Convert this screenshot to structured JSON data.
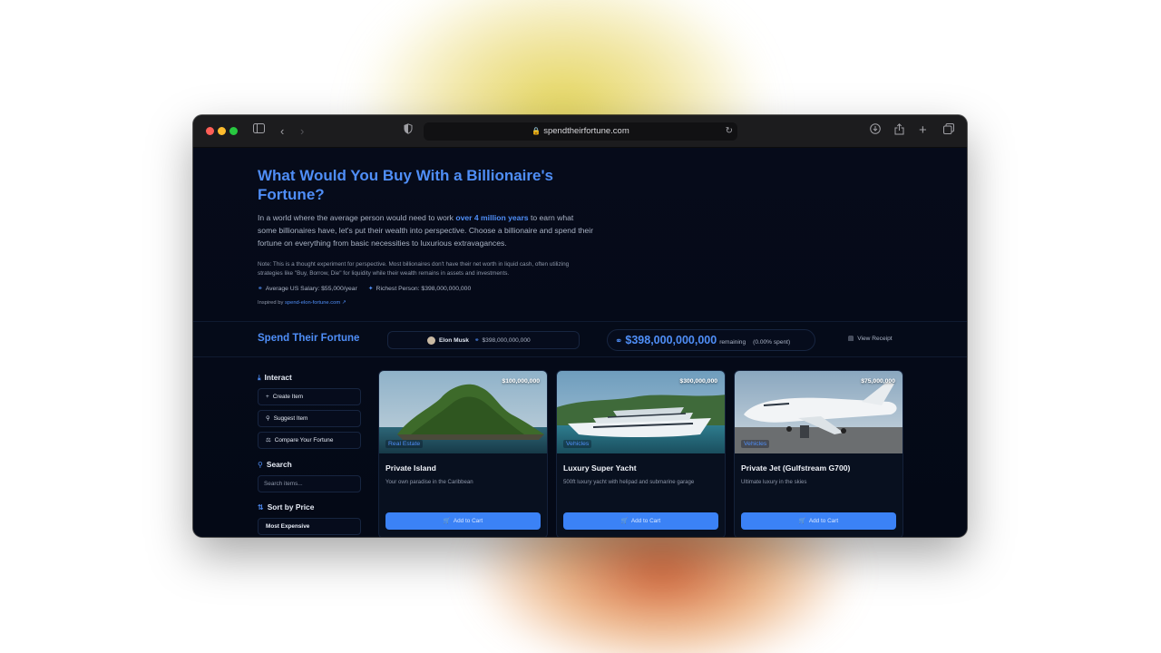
{
  "browser": {
    "url": "spendtheirfortune.com"
  },
  "hero": {
    "title": "What Would You Buy With a Billionaire's Fortune?",
    "desc_before": "In a world where the average person would need to work ",
    "desc_highlight": "over 4 million years",
    "desc_after": " to earn what some billionaires have, let's put their wealth into perspective. Choose a billionaire and spend their fortune on everything from basic necessities to luxurious extravagances.",
    "note": "Note: This is a thought experiment for perspective. Most billionaires don't have their net worth in liquid cash, often utilizing strategies like \"Buy, Borrow, Die\" for liquidity while their wealth remains in assets and investments.",
    "salary": "Average US Salary: $55,000/year",
    "richest": "Richest Person: $398,000,000,000",
    "inspired_label": "Inspired by",
    "inspired_link": "spend-elon-fortune.com"
  },
  "bar": {
    "brand": "Spend Their Fortune",
    "person_name": "Elon Musk",
    "person_worth": "$398,000,000,000",
    "remaining_amount": "$398,000,000,000",
    "remaining_label": "remaining",
    "spent_pct": "(0.00% spent)",
    "receipt_label": "View Receipt"
  },
  "sidebar": {
    "interact_title": "Interact",
    "create_item": "Create Item",
    "suggest_item": "Suggest Item",
    "compare": "Compare Your Fortune",
    "search_title": "Search",
    "search_placeholder": "Search items...",
    "sort_title": "Sort by Price",
    "sort_value": "Most Expensive"
  },
  "items": [
    {
      "price": "$100,000,000",
      "category": "Real Estate",
      "title": "Private Island",
      "desc": "Your own paradise in the Caribbean",
      "button": "Add to Cart"
    },
    {
      "price": "$300,000,000",
      "category": "Vehicles",
      "title": "Luxury Super Yacht",
      "desc": "500ft luxury yacht with helipad and submarine garage",
      "button": "Add to Cart"
    },
    {
      "price": "$75,000,000",
      "category": "Vehicles",
      "title": "Private Jet (Gulfstream G700)",
      "desc": "Ultimate luxury in the skies",
      "button": "Add to Cart"
    }
  ],
  "colors": {
    "accent": "#4f8ef7",
    "button": "#3b82f6",
    "background": "#050a17"
  }
}
